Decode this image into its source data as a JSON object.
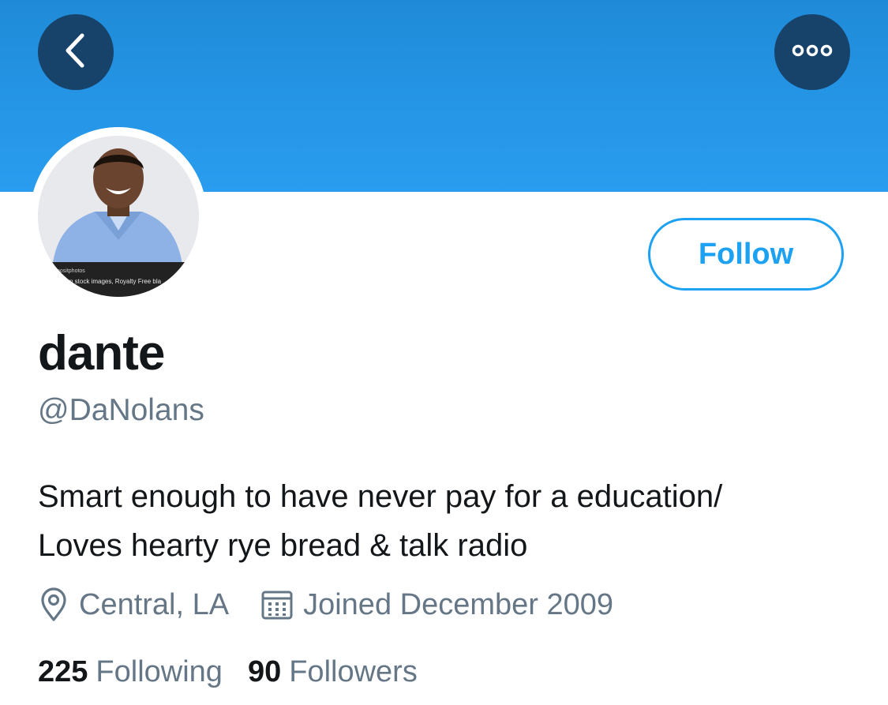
{
  "header": {
    "back_icon": "chevron-left-icon",
    "more_icon": "more-horizontal-icon",
    "banner_color": "#2196e8"
  },
  "profile": {
    "display_name": "dante",
    "handle": "@DaNolans",
    "avatar_watermark_brand": "positphotos",
    "avatar_watermark_text": "n stock images, Royalty Free bla",
    "follow_label": "Follow",
    "bio_lines": [
      "Smart enough to have never pay for a education/",
      "Loves hearty rye bread & talk radio"
    ],
    "location": "Central, LA",
    "location_icon": "location-pin-icon",
    "joined": "Joined December 2009",
    "joined_icon": "calendar-icon",
    "following_count": "225",
    "following_label": "Following",
    "followers_count": "90",
    "followers_label": "Followers"
  },
  "colors": {
    "accent": "#1da1f2",
    "secondary_text": "#657786",
    "primary_text": "#14171a",
    "button_dark": "#17436b"
  }
}
